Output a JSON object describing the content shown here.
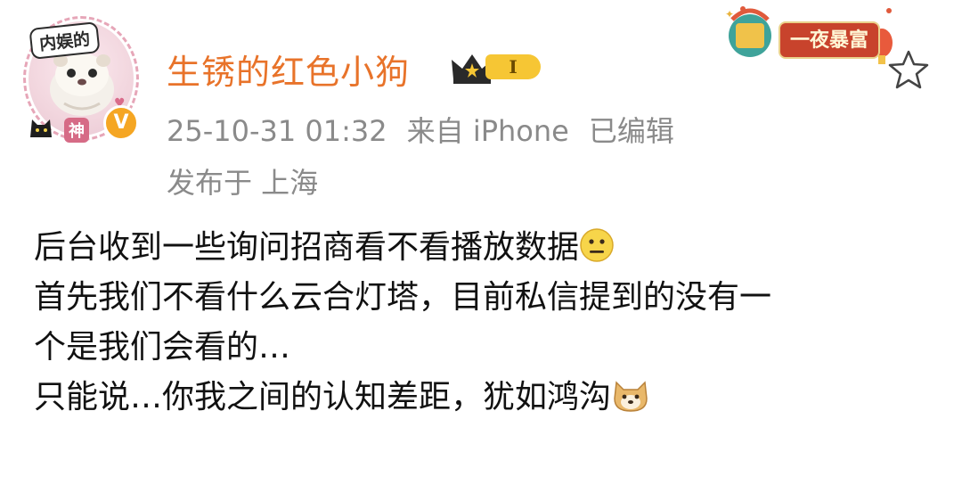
{
  "user": {
    "name": "生锈的红色小狗",
    "avatar_frame_text": "内娱的",
    "avatar_frame_tag": "神",
    "verified_badge": "V",
    "level_badge": "I",
    "icon": "crown-icon"
  },
  "meta": {
    "timestamp": "25-10-31 01:32",
    "source": "来自 iPhone",
    "edited": "已编辑",
    "location": "发布于 上海"
  },
  "pendant": {
    "label": "一夜暴富"
  },
  "post": {
    "line1": "后台收到一些询问招商看不看播放数据",
    "line2": "首先我们不看什么云合灯塔，目前私信提到的没有一",
    "line3": "个是我们会看的…",
    "line4": "只能说…你我之间的认知差距，犹如鸿沟",
    "emoji1": "neutral-face-emoji",
    "emoji2": "doge-emoji"
  },
  "colors": {
    "username": "#e8732a",
    "meta": "#8a8a8a",
    "badge": "#f6c634",
    "verified": "#f5a623"
  }
}
